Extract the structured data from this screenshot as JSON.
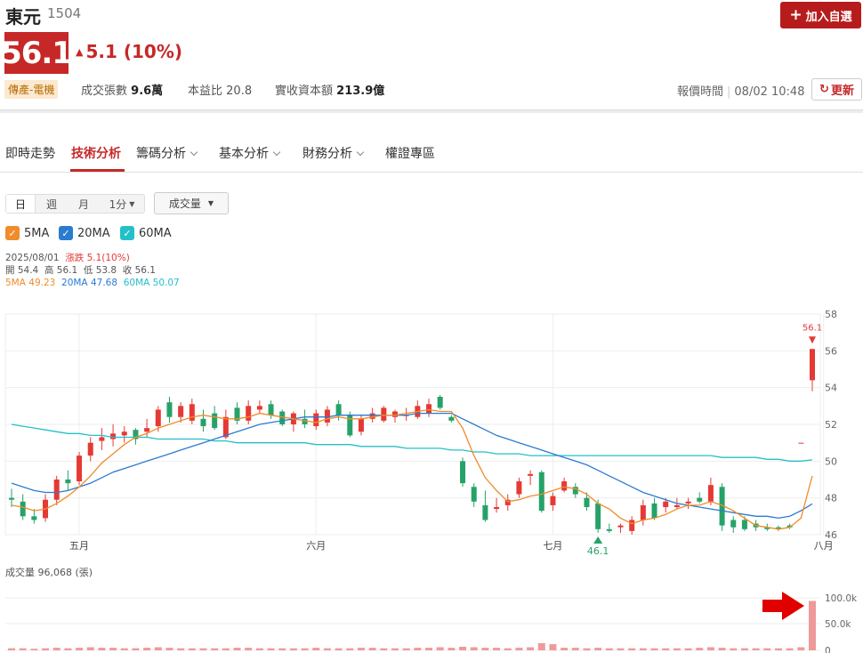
{
  "header": {
    "stock_name": "東元",
    "stock_code": "1504",
    "add_watchlist_label": "加入自選",
    "price": "56.1",
    "change_text": "5.1 (10%)",
    "industry_tag": "傳產-電機",
    "volume_label": "成交張數",
    "volume_value": "9.6萬",
    "pe_label": "本益比",
    "pe_value": "20.8",
    "capital_label": "實收資本額",
    "capital_value": "213.9億",
    "report_time_label": "報價時間",
    "report_time_value": "08/02 10:48",
    "refresh_label": "更新"
  },
  "colors": {
    "up": "#e53935",
    "down": "#26a269",
    "ma5": "#f08c2a",
    "ma20": "#2b7bd0",
    "ma60": "#24c0c8",
    "volume": "#ef9a9a"
  },
  "tabs": [
    {
      "label": "即時走勢",
      "active": false,
      "dropdown": false
    },
    {
      "label": "技術分析",
      "active": true,
      "dropdown": false
    },
    {
      "label": "籌碼分析",
      "active": false,
      "dropdown": true
    },
    {
      "label": "基本分析",
      "active": false,
      "dropdown": true
    },
    {
      "label": "財務分析",
      "active": false,
      "dropdown": true
    },
    {
      "label": "權證專區",
      "active": false,
      "dropdown": false
    }
  ],
  "controls": {
    "periods": [
      "日",
      "週",
      "月",
      "1分"
    ],
    "selected_period": "日",
    "indicator_select": "成交量",
    "ma_toggles": [
      {
        "label": "5MA",
        "checked": true,
        "color": "#f08c2a"
      },
      {
        "label": "20MA",
        "checked": true,
        "color": "#2b7bd0"
      },
      {
        "label": "60MA",
        "checked": true,
        "color": "#24c0c8"
      }
    ]
  },
  "ohlc": {
    "date": "2025/08/01",
    "change_label": "漲跌",
    "change_value": "5.1(10%)",
    "open_label": "開",
    "open": "54.4",
    "high_label": "高",
    "high": "56.1",
    "low_label": "低",
    "low": "53.8",
    "close_label": "收",
    "close": "56.1",
    "ma5_text": "5MA 49.23",
    "ma20_text": "20MA 47.68",
    "ma60_text": "60MA 50.07"
  },
  "chart_data": {
    "type": "candlestick",
    "y_ticks": [
      46,
      48,
      50,
      52,
      54,
      56,
      58
    ],
    "x_labels": [
      {
        "label": "五月",
        "index": 6
      },
      {
        "label": "六月",
        "index": 27
      },
      {
        "label": "七月",
        "index": 48
      },
      {
        "label": "八月",
        "index": 72
      }
    ],
    "last_price_marker": "56.1",
    "low_marker": "46.1",
    "candles": [
      [
        48.0,
        48.5,
        47.5,
        47.9
      ],
      [
        47.8,
        48.2,
        46.8,
        47.0
      ],
      [
        47.0,
        47.4,
        46.6,
        46.8
      ],
      [
        46.9,
        48.2,
        46.7,
        47.9
      ],
      [
        47.9,
        49.2,
        47.6,
        49.0
      ],
      [
        49.0,
        49.5,
        48.4,
        48.8
      ],
      [
        48.9,
        50.5,
        48.7,
        50.3
      ],
      [
        50.3,
        51.3,
        50.0,
        51.0
      ],
      [
        51.1,
        51.8,
        50.6,
        51.3
      ],
      [
        51.2,
        52.0,
        50.8,
        51.5
      ],
      [
        51.4,
        51.9,
        51.0,
        51.6
      ],
      [
        51.7,
        51.8,
        50.9,
        51.2
      ],
      [
        51.6,
        52.3,
        51.3,
        51.8
      ],
      [
        51.9,
        53.0,
        51.6,
        52.8
      ],
      [
        53.2,
        53.5,
        52.1,
        52.4
      ],
      [
        52.4,
        53.2,
        52.1,
        53.0
      ],
      [
        52.2,
        53.4,
        52.0,
        53.1
      ],
      [
        52.3,
        52.8,
        51.6,
        51.9
      ],
      [
        52.6,
        53.0,
        51.7,
        51.8
      ],
      [
        51.3,
        52.8,
        51.2,
        52.4
      ],
      [
        52.9,
        53.2,
        52.0,
        52.2
      ],
      [
        52.2,
        53.3,
        52.0,
        53.0
      ],
      [
        52.8,
        53.3,
        52.6,
        53.0
      ],
      [
        53.1,
        53.3,
        52.3,
        52.5
      ],
      [
        52.7,
        52.8,
        51.9,
        52.0
      ],
      [
        52.0,
        52.7,
        51.6,
        52.6
      ],
      [
        52.3,
        52.8,
        51.8,
        52.0
      ],
      [
        51.9,
        52.8,
        51.7,
        52.6
      ],
      [
        52.1,
        53.0,
        51.9,
        52.8
      ],
      [
        53.1,
        53.3,
        52.2,
        52.5
      ],
      [
        52.5,
        52.7,
        51.3,
        51.4
      ],
      [
        51.6,
        52.5,
        51.4,
        52.3
      ],
      [
        52.3,
        52.9,
        52.1,
        52.6
      ],
      [
        52.2,
        53.0,
        52.1,
        52.9
      ],
      [
        52.4,
        52.8,
        52.1,
        52.7
      ],
      [
        52.5,
        52.9,
        52.2,
        52.5
      ],
      [
        52.4,
        53.3,
        52.3,
        53.0
      ],
      [
        52.6,
        53.4,
        52.4,
        53.1
      ],
      [
        53.5,
        53.6,
        52.8,
        52.9
      ],
      [
        52.4,
        52.5,
        52.1,
        52.2
      ],
      [
        50.0,
        50.2,
        48.6,
        48.8
      ],
      [
        48.6,
        48.8,
        47.5,
        47.8
      ],
      [
        47.6,
        48.4,
        46.7,
        46.8
      ],
      [
        47.4,
        48.0,
        47.2,
        47.5
      ],
      [
        47.6,
        48.2,
        47.3,
        47.9
      ],
      [
        48.2,
        49.1,
        48.0,
        48.9
      ],
      [
        49.2,
        49.5,
        48.7,
        49.3
      ],
      [
        49.4,
        49.5,
        47.2,
        47.3
      ],
      [
        47.6,
        48.3,
        47.3,
        48.1
      ],
      [
        48.4,
        49.1,
        48.3,
        48.9
      ],
      [
        48.6,
        48.8,
        48.0,
        48.2
      ],
      [
        48.0,
        48.3,
        47.3,
        47.5
      ],
      [
        47.7,
        47.9,
        46.1,
        46.3
      ],
      [
        46.3,
        46.6,
        46.1,
        46.2
      ],
      [
        46.4,
        46.6,
        46.1,
        46.5
      ],
      [
        46.2,
        47.0,
        46.0,
        46.8
      ],
      [
        46.8,
        47.9,
        46.5,
        47.6
      ],
      [
        47.7,
        48.0,
        46.8,
        46.9
      ],
      [
        47.5,
        48.0,
        47.2,
        47.8
      ],
      [
        47.5,
        48.0,
        47.4,
        47.6
      ],
      [
        47.7,
        48.0,
        47.4,
        47.8
      ],
      [
        48.0,
        48.3,
        47.7,
        47.8
      ],
      [
        47.8,
        49.1,
        47.6,
        48.7
      ],
      [
        48.6,
        48.8,
        46.2,
        46.5
      ],
      [
        46.8,
        47.0,
        46.1,
        46.4
      ],
      [
        46.8,
        47.0,
        46.2,
        46.3
      ],
      [
        46.6,
        46.8,
        46.2,
        46.4
      ],
      [
        46.4,
        46.6,
        46.2,
        46.3
      ],
      [
        46.4,
        46.5,
        46.2,
        46.3
      ],
      [
        46.5,
        46.6,
        46.3,
        46.4
      ],
      [
        51.0,
        51.0,
        51.0,
        51.0
      ],
      [
        54.4,
        56.1,
        53.8,
        56.1
      ]
    ],
    "ma5": [
      47.6,
      47.5,
      47.3,
      47.4,
      47.7,
      48.1,
      48.6,
      49.2,
      49.9,
      50.4,
      50.9,
      51.3,
      51.5,
      51.8,
      52.0,
      52.2,
      52.4,
      52.5,
      52.4,
      52.3,
      52.3,
      52.4,
      52.6,
      52.5,
      52.4,
      52.3,
      52.2,
      52.1,
      52.3,
      52.4,
      52.3,
      52.3,
      52.4,
      52.5,
      52.5,
      52.6,
      52.7,
      52.8,
      52.7,
      52.7,
      51.8,
      50.3,
      49.1,
      48.4,
      47.8,
      47.9,
      48.1,
      48.2,
      48.4,
      48.6,
      48.5,
      48.2,
      47.7,
      47.4,
      46.9,
      46.6,
      46.8,
      46.9,
      47.1,
      47.4,
      47.6,
      47.6,
      47.8,
      47.6,
      47.3,
      46.9,
      46.5,
      46.4,
      46.3,
      46.4,
      46.9,
      49.2
    ],
    "ma20": [
      48.8,
      48.6,
      48.4,
      48.3,
      48.3,
      48.4,
      48.6,
      48.8,
      49.1,
      49.4,
      49.6,
      49.8,
      50.0,
      50.2,
      50.4,
      50.6,
      50.8,
      51.0,
      51.2,
      51.4,
      51.6,
      51.8,
      52.0,
      52.1,
      52.2,
      52.3,
      52.4,
      52.4,
      52.4,
      52.5,
      52.5,
      52.5,
      52.5,
      52.5,
      52.5,
      52.5,
      52.6,
      52.6,
      52.6,
      52.6,
      52.3,
      52.0,
      51.7,
      51.4,
      51.2,
      51.0,
      50.8,
      50.6,
      50.4,
      50.2,
      50.0,
      49.8,
      49.5,
      49.2,
      48.9,
      48.6,
      48.3,
      48.1,
      47.9,
      47.7,
      47.6,
      47.5,
      47.4,
      47.3,
      47.2,
      47.1,
      47.0,
      47.0,
      46.9,
      47.0,
      47.3,
      47.68
    ],
    "ma60": [
      52.0,
      51.9,
      51.8,
      51.7,
      51.6,
      51.5,
      51.5,
      51.4,
      51.4,
      51.3,
      51.3,
      51.3,
      51.3,
      51.2,
      51.2,
      51.2,
      51.2,
      51.2,
      51.1,
      51.1,
      51.0,
      51.0,
      51.0,
      51.0,
      51.0,
      51.0,
      51.0,
      50.9,
      50.9,
      50.9,
      50.9,
      50.8,
      50.8,
      50.8,
      50.8,
      50.7,
      50.7,
      50.7,
      50.7,
      50.6,
      50.6,
      50.5,
      50.5,
      50.4,
      50.4,
      50.4,
      50.3,
      50.3,
      50.3,
      50.3,
      50.3,
      50.3,
      50.3,
      50.3,
      50.3,
      50.3,
      50.3,
      50.3,
      50.3,
      50.3,
      50.3,
      50.3,
      50.3,
      50.2,
      50.2,
      50.2,
      50.2,
      50.1,
      50.1,
      50.0,
      50.0,
      50.07
    ],
    "volume": {
      "title": "成交量",
      "value_text": "96,068 (張)",
      "y_ticks": [
        "100.0k",
        "50.0k",
        "0"
      ],
      "values": [
        4,
        4,
        3,
        4,
        5,
        4,
        5,
        6,
        5,
        5,
        4,
        4,
        5,
        6,
        5,
        4,
        4,
        4,
        4,
        4,
        5,
        5,
        4,
        4,
        4,
        4,
        4,
        5,
        4,
        4,
        4,
        5,
        5,
        4,
        4,
        4,
        5,
        5,
        6,
        5,
        7,
        6,
        5,
        5,
        4,
        5,
        6,
        14,
        12,
        5,
        5,
        4,
        5,
        4,
        4,
        4,
        4,
        4,
        4,
        4,
        4,
        5,
        6,
        5,
        4,
        4,
        4,
        4,
        4,
        4,
        6,
        96
      ]
    }
  }
}
